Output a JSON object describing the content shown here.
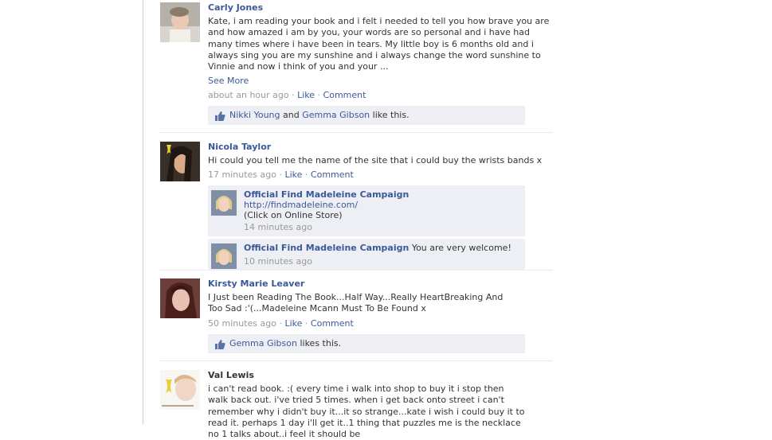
{
  "posts": [
    {
      "author": "Carly Jones",
      "message": "Kate, i am reading your book and i felt i needed to tell you how brave you are and how amazed i am by you, your words are so personal and i have had many times where i have been in tears. My little boy is 6 months old and i always sing you are my sunshine and i always change the word sunshine to Vinnie and now i think of you and your ...",
      "see_more": "See More",
      "time": "about an hour ago",
      "like": "Like",
      "comment": "Comment",
      "likes": {
        "names": [
          "Nikki Young",
          "Gemma Gibson"
        ],
        "and": "and",
        "suffix": "like this."
      }
    },
    {
      "author": "Nicola Taylor",
      "message": "Hi could you tell me the name of the site that i could buy the wrists bands x",
      "time": "17 minutes ago",
      "like": "Like",
      "comment": "Comment",
      "replies": [
        {
          "author": "Official Find Madeleine Campaign",
          "link": "http://findmadeleine.com/",
          "text": "(Click on Online Store)",
          "time": "14 minutes ago"
        },
        {
          "author": "Official Find Madeleine Campaign",
          "text": "You are very welcome!",
          "time": "10 minutes ago"
        }
      ]
    },
    {
      "author": "Kirsty Marie Leaver",
      "message": "I Just been Reading The Book...Half Way...Really HeartBreaking And Too Sad :'(...Madeleine Mcann Must To Be Found x",
      "time": "50 minutes ago",
      "like": "Like",
      "comment": "Comment",
      "likes": {
        "names": [
          "Gemma Gibson"
        ],
        "suffix": "likes this."
      }
    },
    {
      "author": "Val Lewis",
      "message": "i can't read book. :( every time i walk into shop to buy it i stop then walk back out. i've tried 5 times. when i get back onto street i can't remember why i didn't buy it...it so strange...kate i wish i could buy it to read it. perhaps 1 day i'll get it..1 thing that puzzles me is the necklace no 1 talks about..i feel it should be"
    }
  ],
  "separator": " · ",
  "colors": {
    "link": "#3b5998",
    "meta": "#999999",
    "likes_bg": "#edeff4",
    "rail": "#c4cde0"
  },
  "icons": {
    "like": "thumbs-up-icon"
  }
}
